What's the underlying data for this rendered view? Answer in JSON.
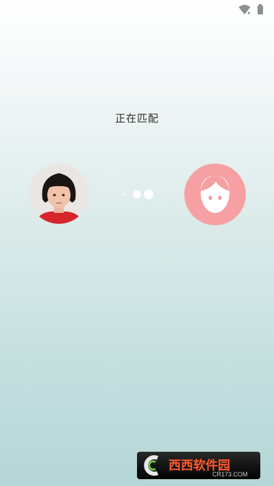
{
  "status_bar": {
    "wifi_icon": "wifi-icon",
    "battery_icon": "battery-icon"
  },
  "match": {
    "status_text": "正在匹配"
  },
  "avatars": {
    "self": "child-photo",
    "partner_icon": "face-icon"
  },
  "colors": {
    "partner_avatar_bg": "#f6a0a3",
    "dots": "#ffffff"
  },
  "watermark": {
    "brand": "西西软件园",
    "url": "CR173.COM"
  }
}
